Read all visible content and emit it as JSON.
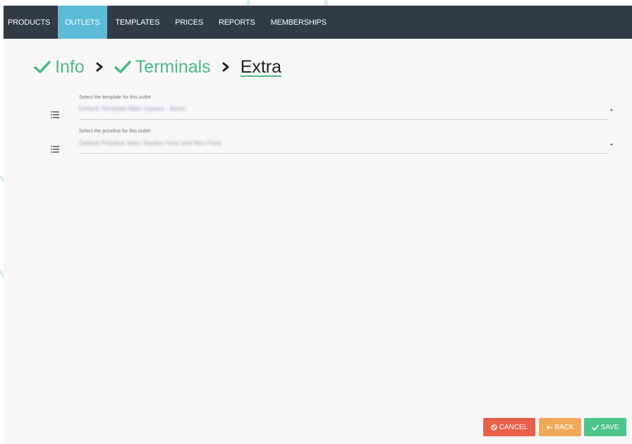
{
  "nav": {
    "items": [
      {
        "label": "PRODUCTS",
        "active": false
      },
      {
        "label": "OUTLETS",
        "active": true
      },
      {
        "label": "TEMPLATES",
        "active": false
      },
      {
        "label": "PRICES",
        "active": false
      },
      {
        "label": "REPORTS",
        "active": false
      },
      {
        "label": "MEMBERSHIPS",
        "active": false
      }
    ]
  },
  "stepper": {
    "steps": [
      {
        "label": "Info",
        "state": "complete"
      },
      {
        "label": "Terminals",
        "state": "complete"
      },
      {
        "label": "Extra",
        "state": "current"
      }
    ]
  },
  "form": {
    "template": {
      "label": "Select the template for this outlet",
      "value": "Default Template Main Square - Basic"
    },
    "priceline": {
      "label": "Select the priceline for this outlet",
      "value": "Default Priceline Main Square Food and Non-Food"
    }
  },
  "actions": {
    "cancel": "CANCEL",
    "back": "BACK",
    "save": "SAVE"
  },
  "colors": {
    "navbar": "#323a45",
    "nav_active": "#5bbad5",
    "accent_green": "#4cba86",
    "cancel": "#e8604c",
    "back": "#f0a95a",
    "save": "#4cc48a"
  },
  "icons": {
    "step_complete": "check-icon",
    "step_separator": "chevron-right-icon",
    "field_icon": "list-icon",
    "cancel": "ban-icon",
    "back": "arrow-left-icon",
    "save": "check-icon"
  }
}
